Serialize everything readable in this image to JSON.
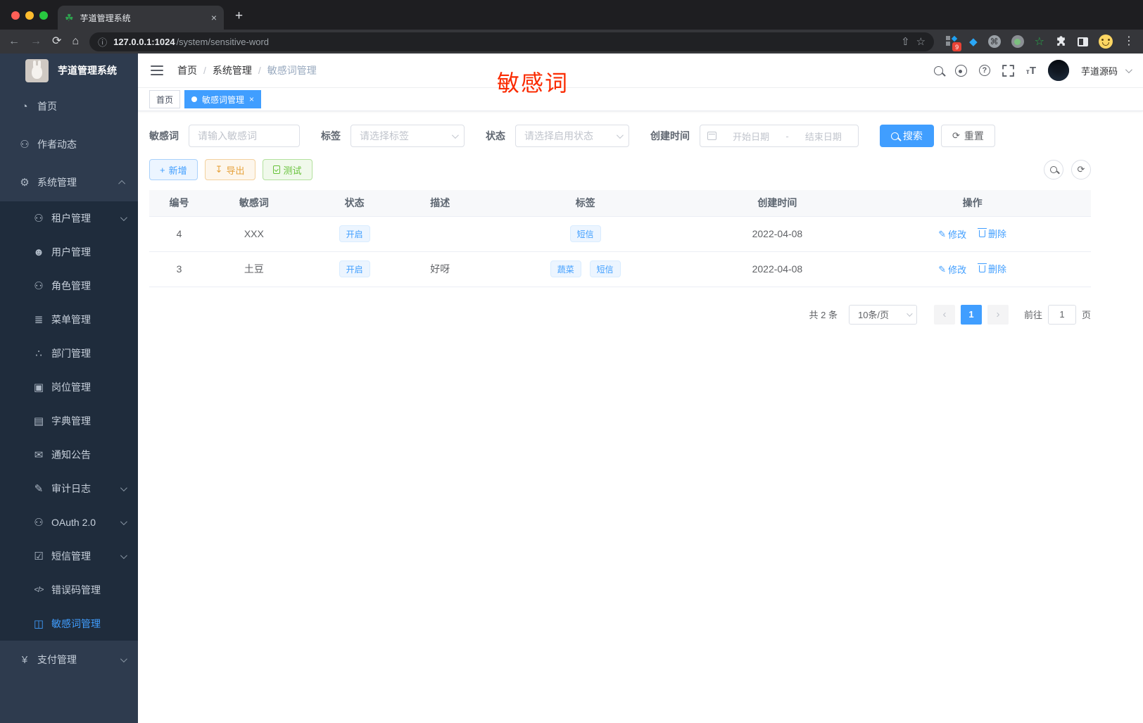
{
  "browser": {
    "tab_title": "芋道管理系统",
    "url_host": "127.0.0.1:1024",
    "url_path": "/system/sensitive-word",
    "ext_badge": "9"
  },
  "icons": {
    "favicon": "☘",
    "tab_close": "×",
    "new_tab": "+",
    "back": "←",
    "forward": "→",
    "reload": "⟳",
    "home": "⌂",
    "info": "ⓘ",
    "share": "⇧",
    "star": "☆",
    "cmd": "⌘",
    "green_star": "☆",
    "kebab": "⋮",
    "gem": "◆",
    "refresh": "⟳",
    "plus": "+",
    "download": "↧",
    "pencil": "✎",
    "prev": "‹",
    "next": "›",
    "tsize_small": "т",
    "tsize_big": "T",
    "question": "?"
  },
  "sidebar": {
    "logo_title": "芋道管理系统",
    "items": [
      {
        "label": "首页",
        "icon": "◔"
      },
      {
        "label": "作者动态",
        "icon": "⚇"
      },
      {
        "label": "系统管理",
        "icon": "⚙"
      },
      {
        "label": "租户管理",
        "icon": "⚇"
      },
      {
        "label": "用户管理",
        "icon": "☻"
      },
      {
        "label": "角色管理",
        "icon": "⚇"
      },
      {
        "label": "菜单管理",
        "icon": "≣"
      },
      {
        "label": "部门管理",
        "icon": "∴"
      },
      {
        "label": "岗位管理",
        "icon": "▣"
      },
      {
        "label": "字典管理",
        "icon": "▤"
      },
      {
        "label": "通知公告",
        "icon": "✉"
      },
      {
        "label": "审计日志",
        "icon": "✎"
      },
      {
        "label": "OAuth 2.0",
        "icon": "⚇"
      },
      {
        "label": "短信管理",
        "icon": "☑"
      },
      {
        "label": "错误码管理",
        "icon": "</>"
      },
      {
        "label": "敏感词管理",
        "icon": "◫"
      },
      {
        "label": "支付管理",
        "icon": "¥"
      }
    ]
  },
  "header": {
    "breadcrumb": [
      "首页",
      "系统管理",
      "敏感词管理"
    ],
    "overlay_text": "敏感词",
    "username": "芋道源码"
  },
  "tabsbar": {
    "home": "首页",
    "active": "敏感词管理"
  },
  "filters": {
    "word_label": "敏感词",
    "word_placeholder": "请输入敏感词",
    "tag_label": "标签",
    "tag_placeholder": "请选择标签",
    "status_label": "状态",
    "status_placeholder": "请选择启用状态",
    "time_label": "创建时间",
    "start_placeholder": "开始日期",
    "range_sep": "-",
    "end_placeholder": "结束日期",
    "search_label": "搜索",
    "reset_label": "重置"
  },
  "actions": {
    "add": "新增",
    "export": "导出",
    "test": "测试"
  },
  "table": {
    "columns": [
      "编号",
      "敏感词",
      "状态",
      "描述",
      "标签",
      "创建时间",
      "操作"
    ],
    "ops": {
      "edit": "修改",
      "del": "删除"
    },
    "rows": [
      {
        "id": "4",
        "word": "XXX",
        "status": "开启",
        "desc": "",
        "tags": [
          "短信"
        ],
        "created": "2022-04-08"
      },
      {
        "id": "3",
        "word": "土豆",
        "status": "开启",
        "desc": "好呀",
        "tags": [
          "蔬菜",
          "短信"
        ],
        "created": "2022-04-08"
      }
    ]
  },
  "pagination": {
    "total": "共 2 条",
    "size": "10条/页",
    "current": "1",
    "goto_label": "前往",
    "goto_value": "1",
    "unit_label": "页"
  },
  "colors": {
    "primary": "#409eff",
    "warning": "#e6a23c",
    "success": "#67c23a",
    "overlay_red": "#fa2b01",
    "sidebar_bg": "#2e3b4e",
    "submenu_bg": "#1f2c3c"
  }
}
